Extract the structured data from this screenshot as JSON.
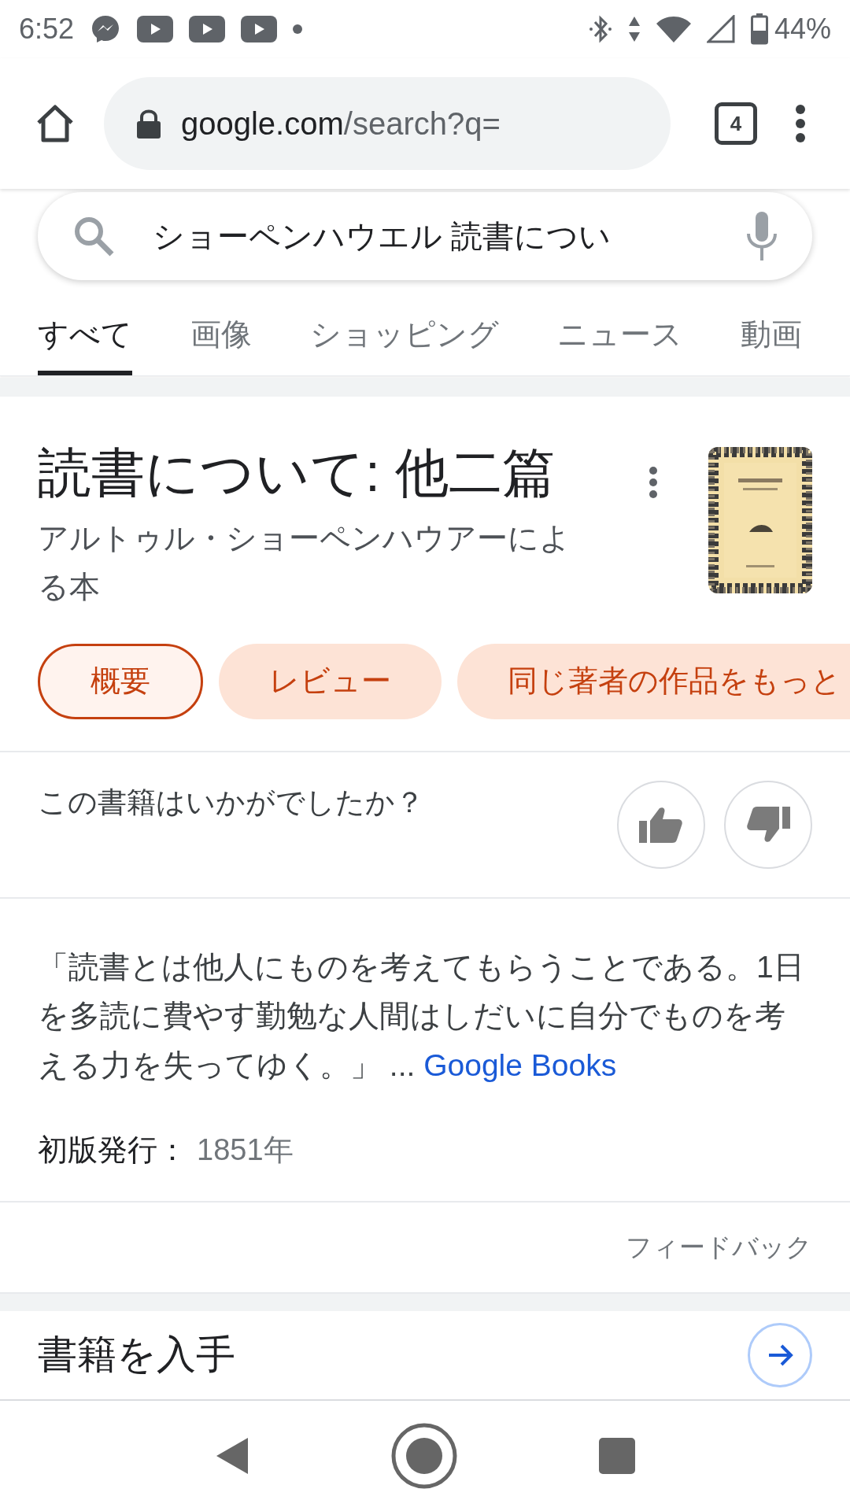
{
  "status_bar": {
    "time": "6:52",
    "battery": "44%"
  },
  "browser": {
    "url_host": "google.com",
    "url_path": "/search?q=",
    "tab_count": "4"
  },
  "search": {
    "value": "ショーペンハウエル 読書につい"
  },
  "tabs": [
    {
      "label": "すべて",
      "selected": true
    },
    {
      "label": "画像",
      "selected": false
    },
    {
      "label": "ショッピング",
      "selected": false
    },
    {
      "label": "ニュース",
      "selected": false
    },
    {
      "label": "動画",
      "selected": false
    }
  ],
  "book": {
    "title": "読書について: 他二篇",
    "subtitle": "アルトゥル・ショーペンハウアーによる本",
    "chips": [
      {
        "label": "概要",
        "selected": true
      },
      {
        "label": "レビュー",
        "selected": false
      },
      {
        "label": "同じ著者の作品をもっと",
        "selected": false
      }
    ],
    "rating_question": "この書籍はいかがでしたか？",
    "quote": "「読書とは他人にものを考えてもらうことである。1日を多読に費やす勤勉な人間はしだいに自分でものを考える力を失ってゆく。」 ...",
    "quote_source": "Google Books",
    "first_published_label": "初版発行：",
    "first_published_value": "1851年",
    "feedback": "フィードバック"
  },
  "next_section": {
    "title": "書籍を入手"
  }
}
